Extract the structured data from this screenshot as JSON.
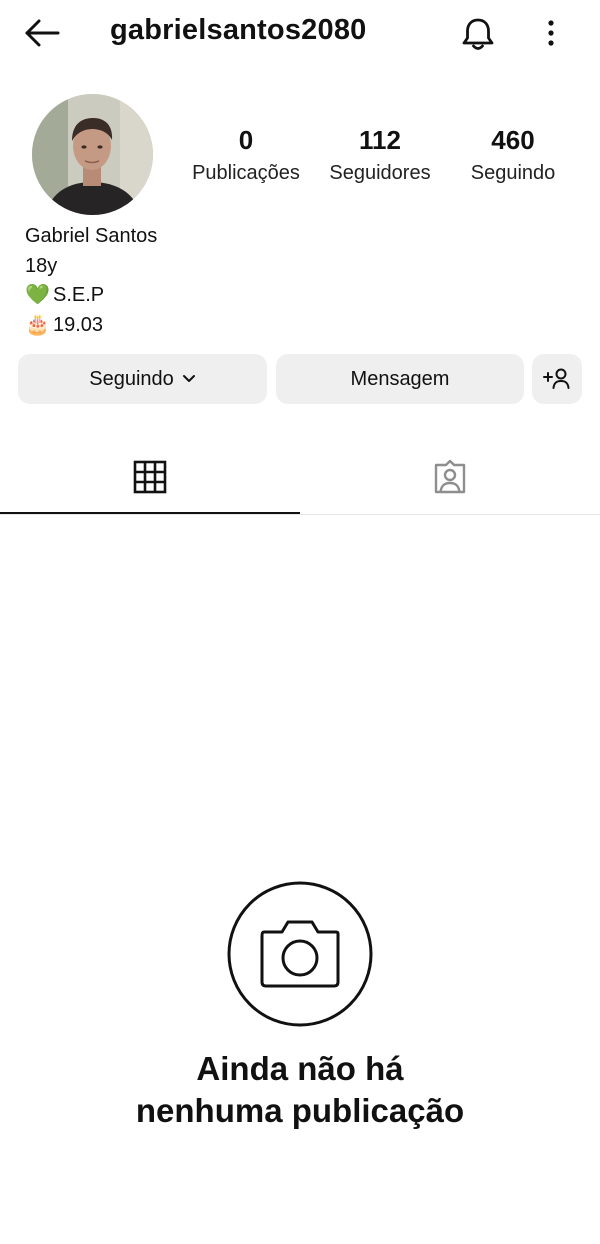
{
  "header": {
    "username": "gabrielsantos2080",
    "back_icon": "arrow-left-icon",
    "notifications_icon": "bell-icon",
    "menu_icon": "more-vertical-icon"
  },
  "profile": {
    "avatar": "profile-photo",
    "stats": [
      {
        "value": "0",
        "label": "Publicações"
      },
      {
        "value": "112",
        "label": "Seguidores"
      },
      {
        "value": "460",
        "label": "Seguindo"
      }
    ],
    "name": "Gabriel Santos",
    "bio_lines": [
      {
        "emoji": "",
        "text": "18y"
      },
      {
        "emoji": "💚",
        "text": "S.E.P"
      },
      {
        "emoji": "🎂",
        "text": "19.03"
      }
    ]
  },
  "actions": {
    "following_label": "Seguindo",
    "message_label": "Mensagem",
    "add_user_icon": "add-person-icon"
  },
  "tabs": [
    {
      "icon": "grid-icon",
      "selected": true
    },
    {
      "icon": "tagged-person-icon",
      "selected": false
    }
  ],
  "empty_state": {
    "icon": "camera-icon",
    "line1": "Ainda não há",
    "line2": "nenhuma publicação"
  },
  "colors": {
    "button_bg": "#efefef",
    "text": "#111111",
    "muted_icon": "#8e8e8e"
  }
}
